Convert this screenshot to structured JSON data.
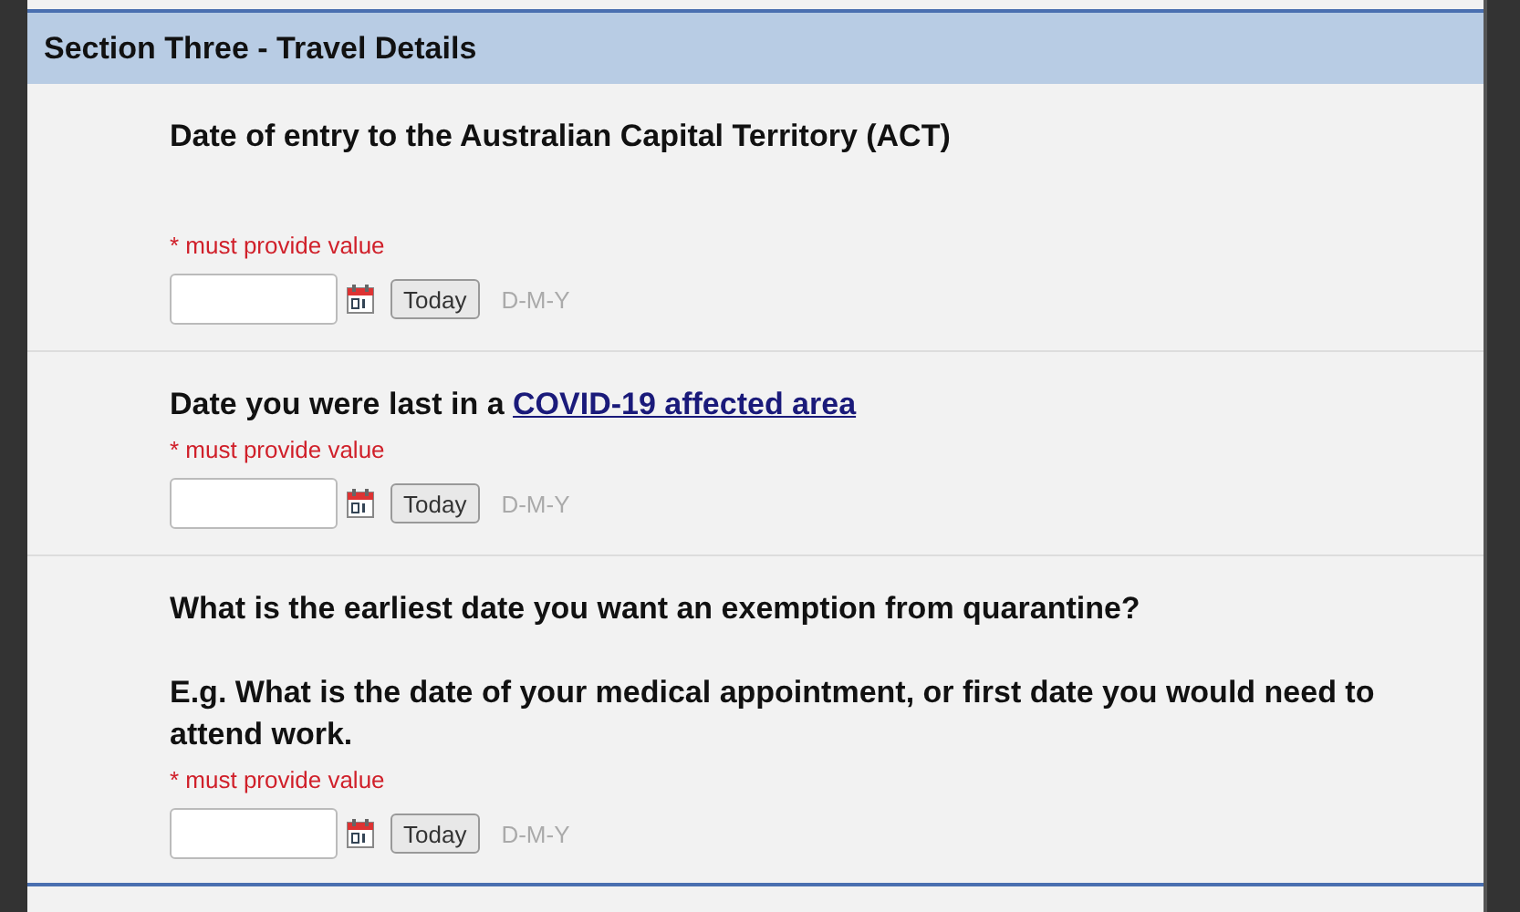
{
  "section": {
    "title": "Section Three - Travel Details"
  },
  "questions": [
    {
      "text": "Date of entry to the Australian Capital Territory (ACT)",
      "required": "* must provide value",
      "button": "Today",
      "format": "D-M-Y"
    },
    {
      "text": "Date you were last in a ",
      "link": "COVID-19 affected area",
      "required": "* must provide value",
      "button": "Today",
      "format": "D-M-Y"
    },
    {
      "text": "What is the earliest date you want an exemption from quarantine?",
      "note": "E.g. What is the date of your medical appointment, or first date you would need to attend work.",
      "required": "* must provide value",
      "button": "Today",
      "format": "D-M-Y"
    }
  ]
}
